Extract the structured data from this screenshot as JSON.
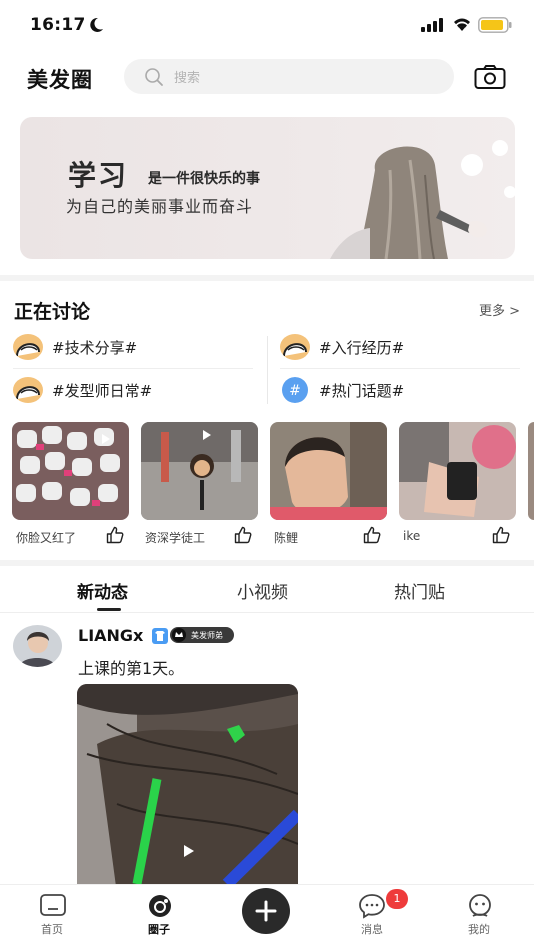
{
  "status_bar": {
    "time": "16:17"
  },
  "header": {
    "app_title": "美发圈",
    "search_placeholder": "搜索"
  },
  "banner": {
    "big": "学习",
    "small": "是一件很快乐的事",
    "subtitle": "为自己的美丽事业而奋斗"
  },
  "discussion": {
    "title": "正在讨论",
    "more": "更多 >",
    "topics": [
      {
        "label": "#技术分享#"
      },
      {
        "label": "#入行经历#"
      },
      {
        "label": "#发型师日常#"
      },
      {
        "label": "#热门话题#"
      }
    ]
  },
  "thumbnails": [
    {
      "caption": "你脸又红了"
    },
    {
      "caption": "资深学徒工"
    },
    {
      "caption": "陈鲤"
    },
    {
      "caption": "ike"
    }
  ],
  "feed_tabs": [
    {
      "label": "新动态",
      "active": true
    },
    {
      "label": "小视频",
      "active": false
    },
    {
      "label": "热门贴",
      "active": false
    }
  ],
  "post": {
    "username": "LIANGx",
    "badge_text": "美发师弟",
    "text": "上课的第1天。"
  },
  "bottom_nav": {
    "items": [
      {
        "label": "首页",
        "icon": "home-icon"
      },
      {
        "label": "圈子",
        "icon": "circle-icon",
        "active": true
      },
      {
        "label": "",
        "icon": "plus-icon"
      },
      {
        "label": "消息",
        "icon": "message-icon"
      },
      {
        "label": "我的",
        "icon": "profile-icon"
      }
    ],
    "message_badge": "1"
  },
  "colors": {
    "accent": "#ee3b3b",
    "battery": "#f5c518",
    "topic_hash": "#5aa0f0"
  }
}
